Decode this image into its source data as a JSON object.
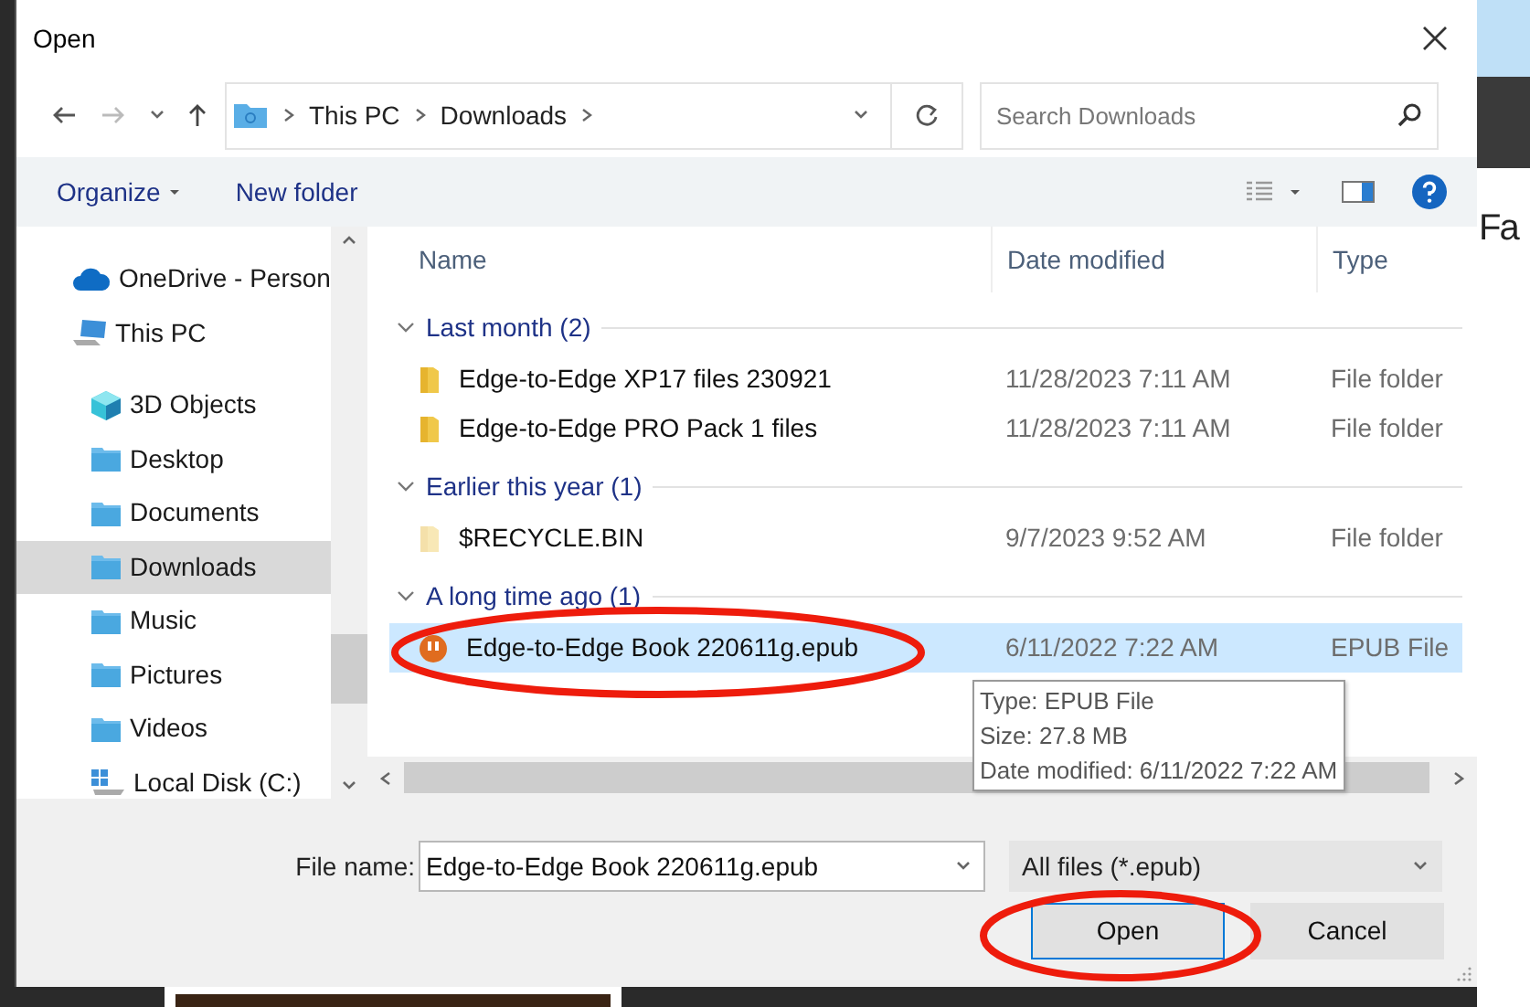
{
  "background": {
    "text": "Fa"
  },
  "window": {
    "title": "Open"
  },
  "navigation": {
    "path": [
      "This PC",
      "Downloads"
    ],
    "search": {
      "placeholder": "Search Downloads"
    }
  },
  "toolbar": {
    "buttons": [
      {
        "label": "Organize",
        "dropdown": true
      },
      {
        "label": "New folder",
        "dropdown": false
      }
    ]
  },
  "sidebar": {
    "items": [
      {
        "label": "OneDrive - Person",
        "kind": "cloud",
        "selected": false
      },
      {
        "label": "This PC",
        "kind": "pc",
        "selected": false,
        "children": [
          {
            "label": "3D Objects",
            "kind": "cube",
            "selected": false
          },
          {
            "label": "Desktop",
            "kind": "folder",
            "selected": false
          },
          {
            "label": "Documents",
            "kind": "folder",
            "selected": false
          },
          {
            "label": "Downloads",
            "kind": "folder",
            "selected": true
          },
          {
            "label": "Music",
            "kind": "folder",
            "selected": false
          },
          {
            "label": "Pictures",
            "kind": "folder",
            "selected": false
          },
          {
            "label": "Videos",
            "kind": "folder",
            "selected": false
          },
          {
            "label": "Local Disk (C:)",
            "kind": "drive",
            "selected": false
          }
        ]
      }
    ]
  },
  "file_list": {
    "columns": [
      "Name",
      "Date modified",
      "Type"
    ],
    "groups": [
      {
        "label": "Last month (2)",
        "expanded": true,
        "items": [
          {
            "name": "Edge-to-Edge XP17 files 230921",
            "date": "11/28/2023 7:11 AM",
            "type": "File folder",
            "kind": "folder",
            "hidden": false,
            "selected": false
          },
          {
            "name": "Edge-to-Edge PRO Pack 1 files",
            "date": "11/28/2023 7:11 AM",
            "type": "File folder",
            "kind": "folder",
            "hidden": false,
            "selected": false
          }
        ]
      },
      {
        "label": "Earlier this year (1)",
        "expanded": true,
        "items": [
          {
            "name": "$RECYCLE.BIN",
            "date": "9/7/2023 9:52 AM",
            "type": "File folder",
            "kind": "folder",
            "hidden": true,
            "selected": false
          }
        ]
      },
      {
        "label": "A long time ago (1)",
        "expanded": true,
        "items": [
          {
            "name": "Edge-to-Edge Book 220611g.epub",
            "date": "6/11/2022 7:22 AM",
            "type": "EPUB File",
            "kind": "epub",
            "hidden": false,
            "selected": true
          }
        ]
      }
    ]
  },
  "tooltip": {
    "lines": [
      "Type: EPUB File",
      "Size: 27.8 MB",
      "Date modified: 6/11/2022 7:22 AM"
    ]
  },
  "footer": {
    "file_name_label": "File name:",
    "file_name": "Edge-to-Edge Book 220611g.epub",
    "filter": "All files (*.epub)",
    "buttons": [
      {
        "label": "Open",
        "default": true
      },
      {
        "label": "Cancel",
        "default": false
      }
    ]
  }
}
